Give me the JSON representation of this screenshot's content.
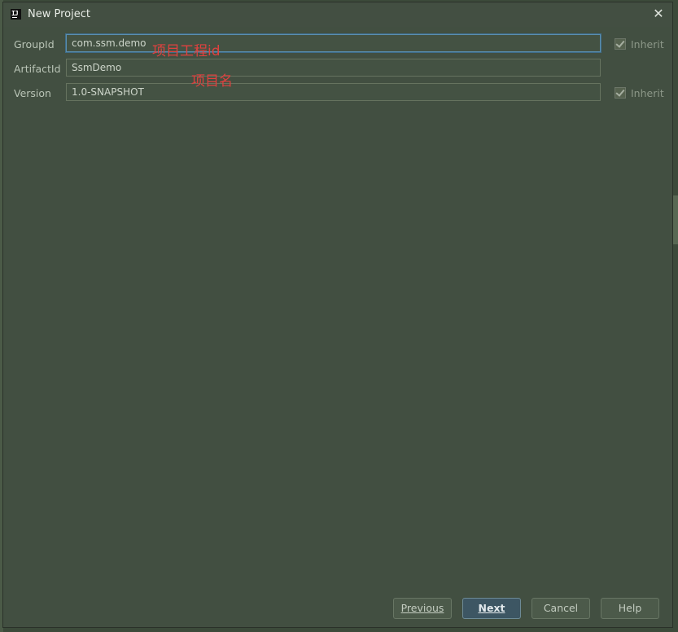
{
  "window": {
    "title": "New Project",
    "app_icon_text": "IJ"
  },
  "form": {
    "groupid": {
      "label": "GroupId",
      "value": "com.ssm.demo",
      "inherit_label": "Inherit"
    },
    "artifactid": {
      "label": "ArtifactId",
      "value": "SsmDemo"
    },
    "version": {
      "label": "Version",
      "value": "1.0-SNAPSHOT",
      "inherit_label": "Inherit"
    }
  },
  "annotations": {
    "groupid_note": "项目工程id",
    "artifactid_note": "项目名"
  },
  "buttons": {
    "previous": "Previous",
    "next": "Next",
    "cancel": "Cancel",
    "help": "Help"
  },
  "colors": {
    "dialog_bg": "#424f41",
    "annotation": "#e0413f",
    "focus": "#5a8fb0"
  }
}
